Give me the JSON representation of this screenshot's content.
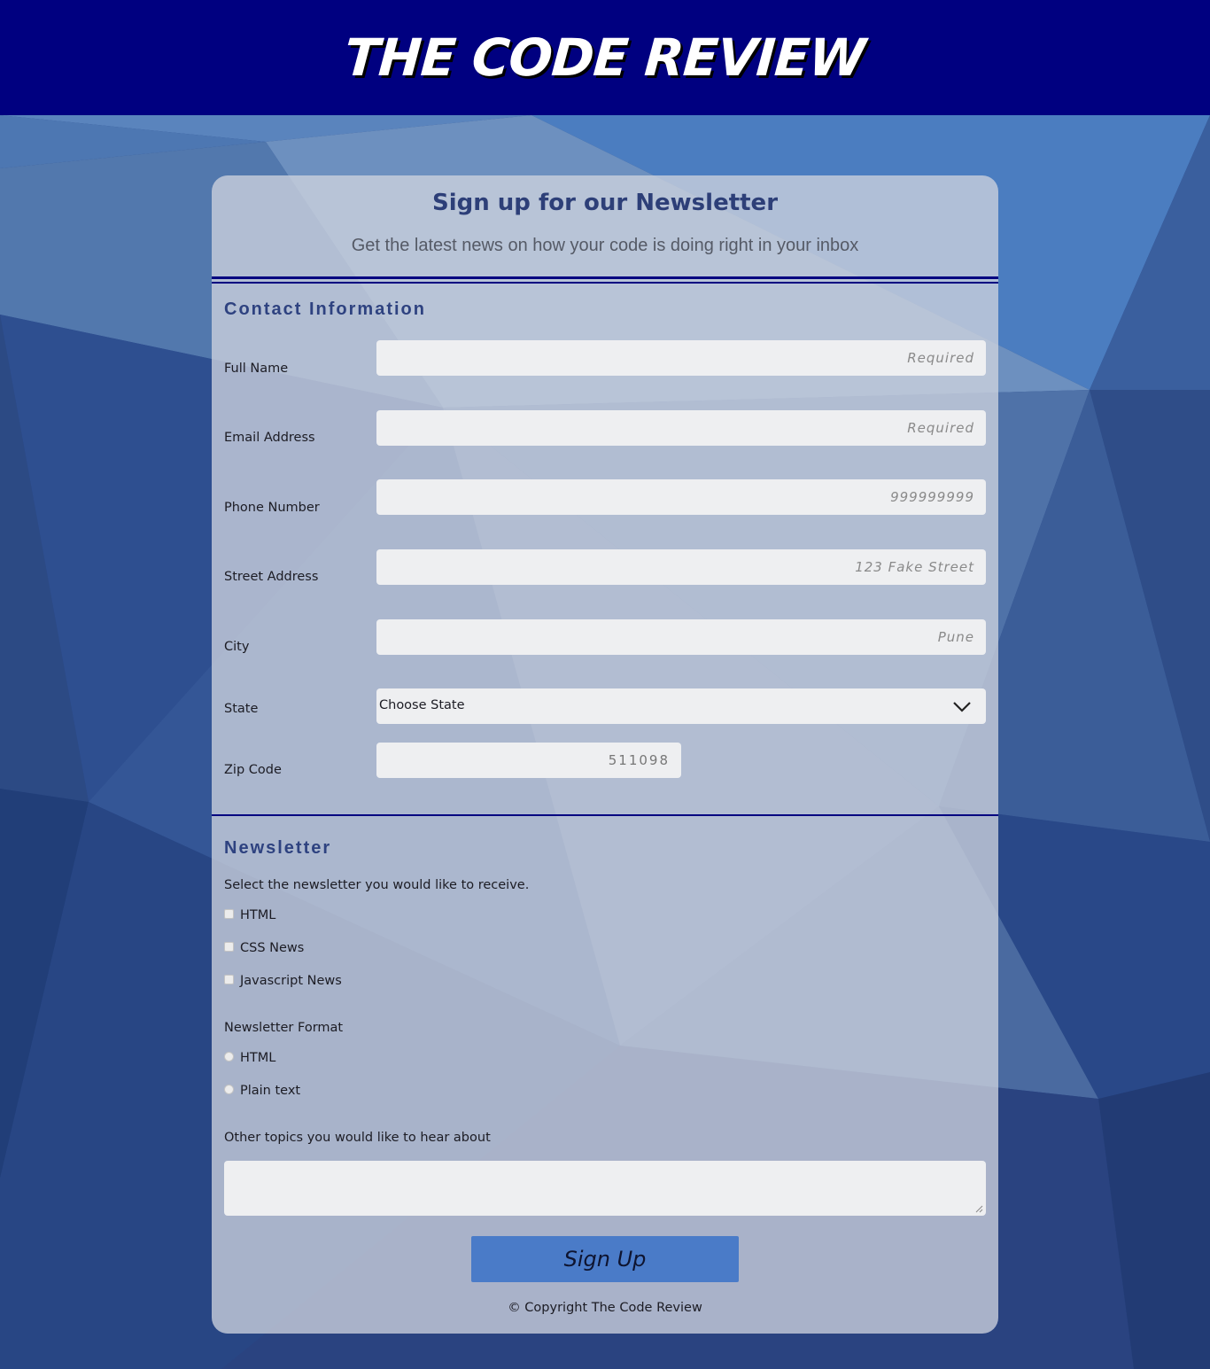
{
  "header": {
    "title": "THE CODE REVIEW"
  },
  "card": {
    "title": "Sign up for our Newsletter",
    "subtitle": "Get the latest news on how your code is doing right in your inbox"
  },
  "contact": {
    "heading": "Contact Information",
    "fields": [
      {
        "label": "Full Name",
        "placeholder": "Required"
      },
      {
        "label": "Email Address",
        "placeholder": "Required"
      },
      {
        "label": "Phone Number",
        "placeholder": "999999999"
      },
      {
        "label": "Street Address",
        "placeholder": "123 Fake Street"
      },
      {
        "label": "City",
        "placeholder": "Pune"
      }
    ],
    "state": {
      "label": "State",
      "selected": "Choose State"
    },
    "zip": {
      "label": "Zip Code",
      "placeholder": "511098"
    }
  },
  "newsletter": {
    "heading": "Newsletter",
    "prompt": "Select the newsletter you would like to receive.",
    "options": [
      "HTML",
      "CSS News",
      "Javascript News"
    ],
    "format_label": "Newsletter Format",
    "formats": [
      "HTML",
      "Plain text"
    ],
    "topics_label": "Other topics you would like to hear about"
  },
  "submit_label": "Sign Up",
  "footer": {
    "copyright": "© Copyright The Code Review"
  },
  "colors": {
    "header_bg": "#000080",
    "button_bg": "#4a7bc8",
    "heading_text": "#2e4280"
  },
  "icons": {
    "select_arrow": "chevron-down-icon"
  }
}
